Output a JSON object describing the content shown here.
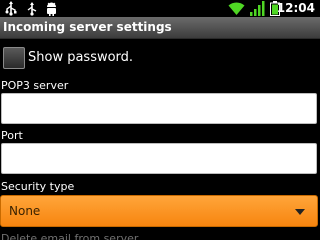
{
  "status_bar": {
    "time": "12:04",
    "icons": [
      "usb-icon",
      "usb-debug-icon",
      "android-icon",
      "wifi-icon",
      "signal-icon",
      "battery-icon"
    ]
  },
  "title": "Incoming server settings",
  "show_password": {
    "label": "Show password.",
    "checked": false
  },
  "pop3_server": {
    "label": "POP3 server",
    "value": ""
  },
  "port": {
    "label": "Port",
    "value": ""
  },
  "security_type": {
    "label": "Security type",
    "selected": "None"
  },
  "delete_email": {
    "label": "Delete email from server"
  },
  "colors": {
    "accent": "#f7850f",
    "title_bar": "#4a4a4a",
    "background": "#000000"
  }
}
